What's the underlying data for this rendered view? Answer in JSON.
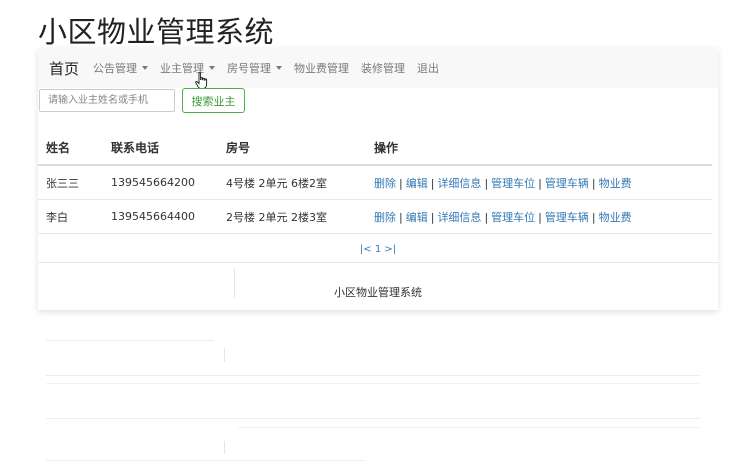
{
  "app": {
    "title": "小区物业管理系统"
  },
  "navbar": {
    "brand": "首页",
    "items": [
      {
        "label": "公告管理",
        "dropdown": true
      },
      {
        "label": "业主管理",
        "dropdown": true
      },
      {
        "label": "房号管理",
        "dropdown": true
      },
      {
        "label": "物业费管理",
        "dropdown": false
      },
      {
        "label": "装修管理",
        "dropdown": false
      },
      {
        "label": "退出",
        "dropdown": false
      }
    ]
  },
  "search": {
    "placeholder": "请输入业主姓名或手机",
    "value": "",
    "button_label": "搜索业主"
  },
  "table": {
    "headers": [
      "姓名",
      "联系电话",
      "房号",
      "操作"
    ],
    "rows": [
      {
        "name": "张三三",
        "phone": "139545664200",
        "room": "4号楼 2单元 6楼2室"
      },
      {
        "name": "李白",
        "phone": "139545664400",
        "room": "2号楼 2单元 2楼3室"
      }
    ],
    "actions": [
      "删除",
      "编辑",
      "详细信息",
      "管理车位",
      "管理车辆",
      "物业费"
    ]
  },
  "pagination": {
    "text": "|< 1 >|"
  },
  "footer": {
    "text": "小区物业管理系统"
  },
  "colors": {
    "link": "#337ab7",
    "button_border": "#4cae4c",
    "navbar_bg": "#f8f8f8"
  }
}
